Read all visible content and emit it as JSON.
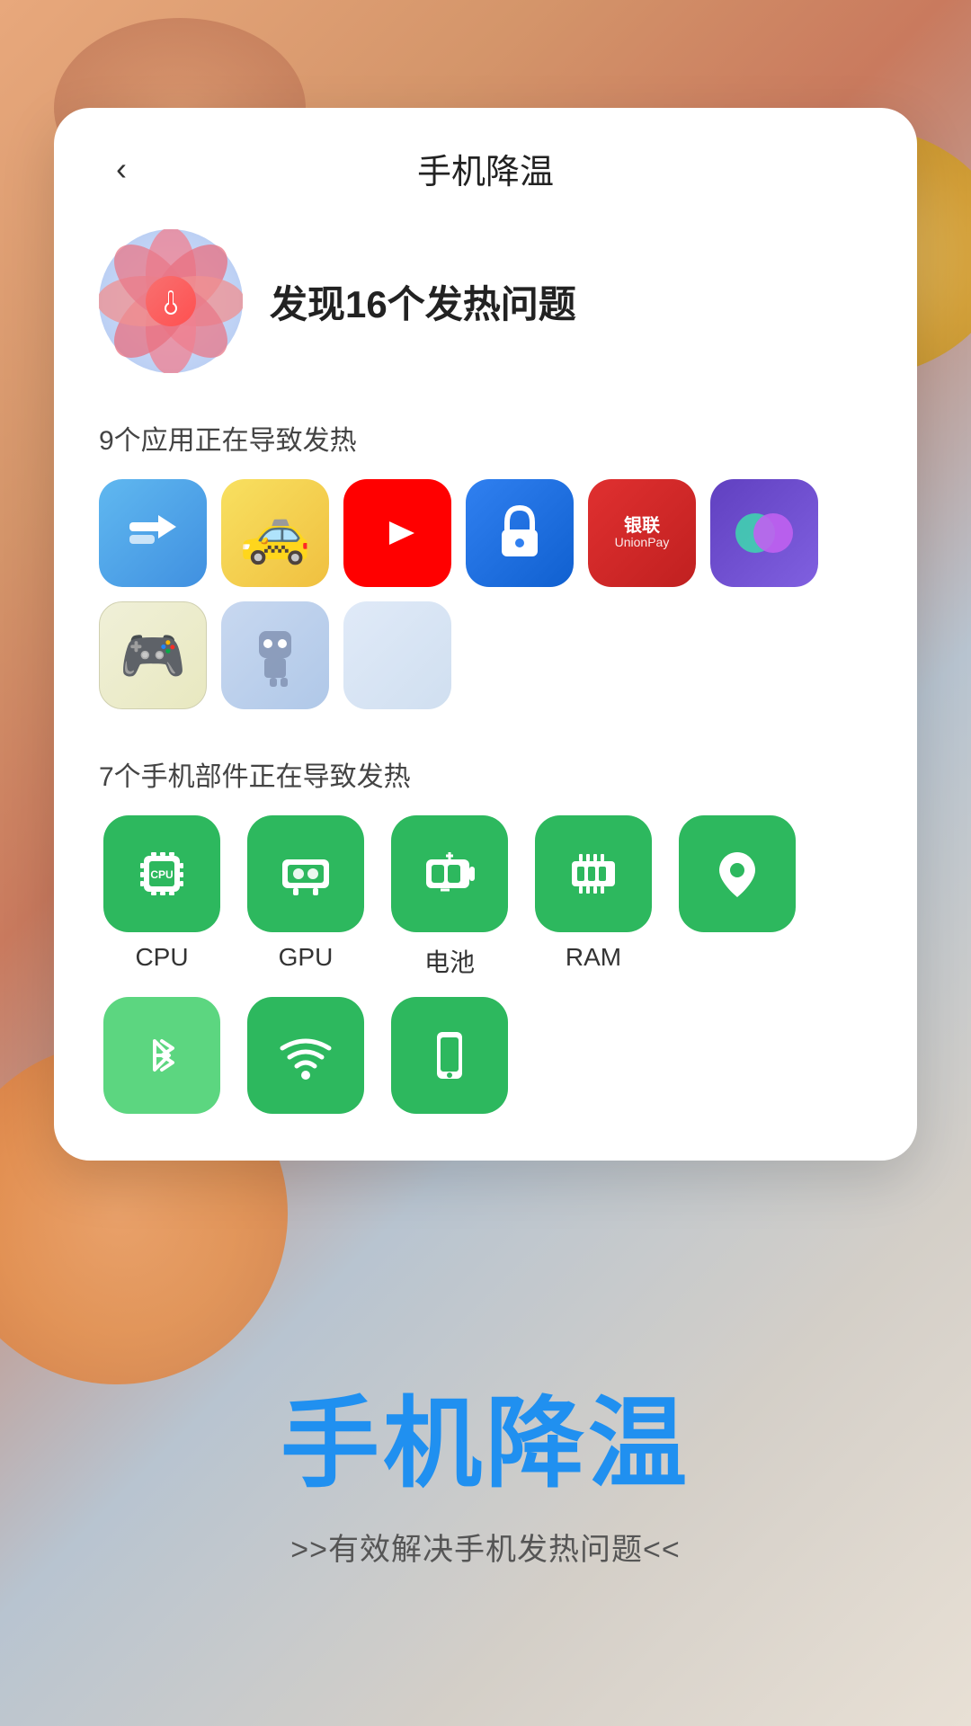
{
  "background": {
    "colors": {
      "primary": "#e8a87c",
      "secondary": "#b8c4d0",
      "tertiary": "#d4a030"
    }
  },
  "card": {
    "back_label": "‹",
    "title": "手机降温",
    "heat_title": "发现16个发热问题",
    "app_section_title": "9个应用正在导致发热",
    "component_section_title": "7个手机部件正在导致发热",
    "apps": [
      {
        "name": "green-arrow-app",
        "emoji": "→",
        "class": "app-green-arrow"
      },
      {
        "name": "taxi-app",
        "emoji": "🚕",
        "class": "app-taxi"
      },
      {
        "name": "youtube-app",
        "emoji": "▶",
        "class": "app-youtube"
      },
      {
        "name": "lock-app",
        "emoji": "🔒",
        "class": "app-lock"
      },
      {
        "name": "unionpay-app",
        "emoji": "银联",
        "class": "app-unionpay",
        "small_text": true
      },
      {
        "name": "toggle-app",
        "emoji": "⬤",
        "class": "app-toggle"
      },
      {
        "name": "gamepad-app",
        "emoji": "🎮",
        "class": "app-gamepad"
      },
      {
        "name": "robot-app",
        "emoji": "🤖",
        "class": "app-robot"
      },
      {
        "name": "empty-app",
        "emoji": "",
        "class": "app-empty"
      }
    ],
    "components": [
      {
        "name": "cpu",
        "label": "CPU",
        "icon": "cpu-icon",
        "shade": "dark"
      },
      {
        "name": "gpu",
        "label": "GPU",
        "icon": "gpu-icon",
        "shade": "dark"
      },
      {
        "name": "battery",
        "label": "电池",
        "icon": "battery-icon",
        "shade": "dark"
      },
      {
        "name": "ram",
        "label": "RAM",
        "icon": "ram-icon",
        "shade": "dark"
      },
      {
        "name": "location",
        "label": "",
        "icon": "location-icon",
        "shade": "dark"
      },
      {
        "name": "bluetooth",
        "label": "",
        "icon": "bluetooth-icon",
        "shade": "light"
      },
      {
        "name": "wifi",
        "label": "",
        "icon": "wifi-icon",
        "shade": "dark"
      },
      {
        "name": "screen",
        "label": "",
        "icon": "screen-icon",
        "shade": "dark"
      }
    ]
  },
  "bottom": {
    "main_title": "手机降温",
    "subtitle": ">>有效解决手机发热问题<<"
  }
}
